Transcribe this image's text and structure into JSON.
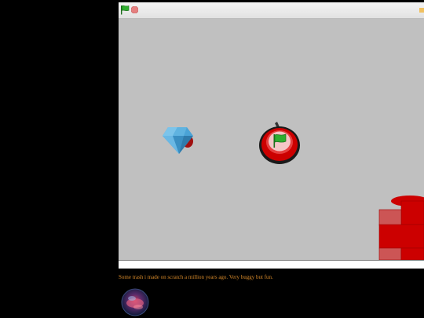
{
  "player": {
    "green_flag_icon": "green-flag-icon",
    "stop_icon": "stop-sign-icon",
    "fullscreen_icon": "fullscreen-icon",
    "colors": {
      "stage_background": "#c0c0c0",
      "flag_green": "#2fae2f",
      "stop_red": "#e58080",
      "building_red": "#cc0000",
      "gem_blue": "#4aa3d6"
    }
  },
  "stage": {
    "sprites": [
      "diamond-gem",
      "apple-flag-target",
      "red-building"
    ]
  },
  "project": {
    "description": "Some trash i made on scratch a million years ago. Very buggy but fun."
  },
  "author": {
    "avatar_icon": "avatar-image"
  }
}
